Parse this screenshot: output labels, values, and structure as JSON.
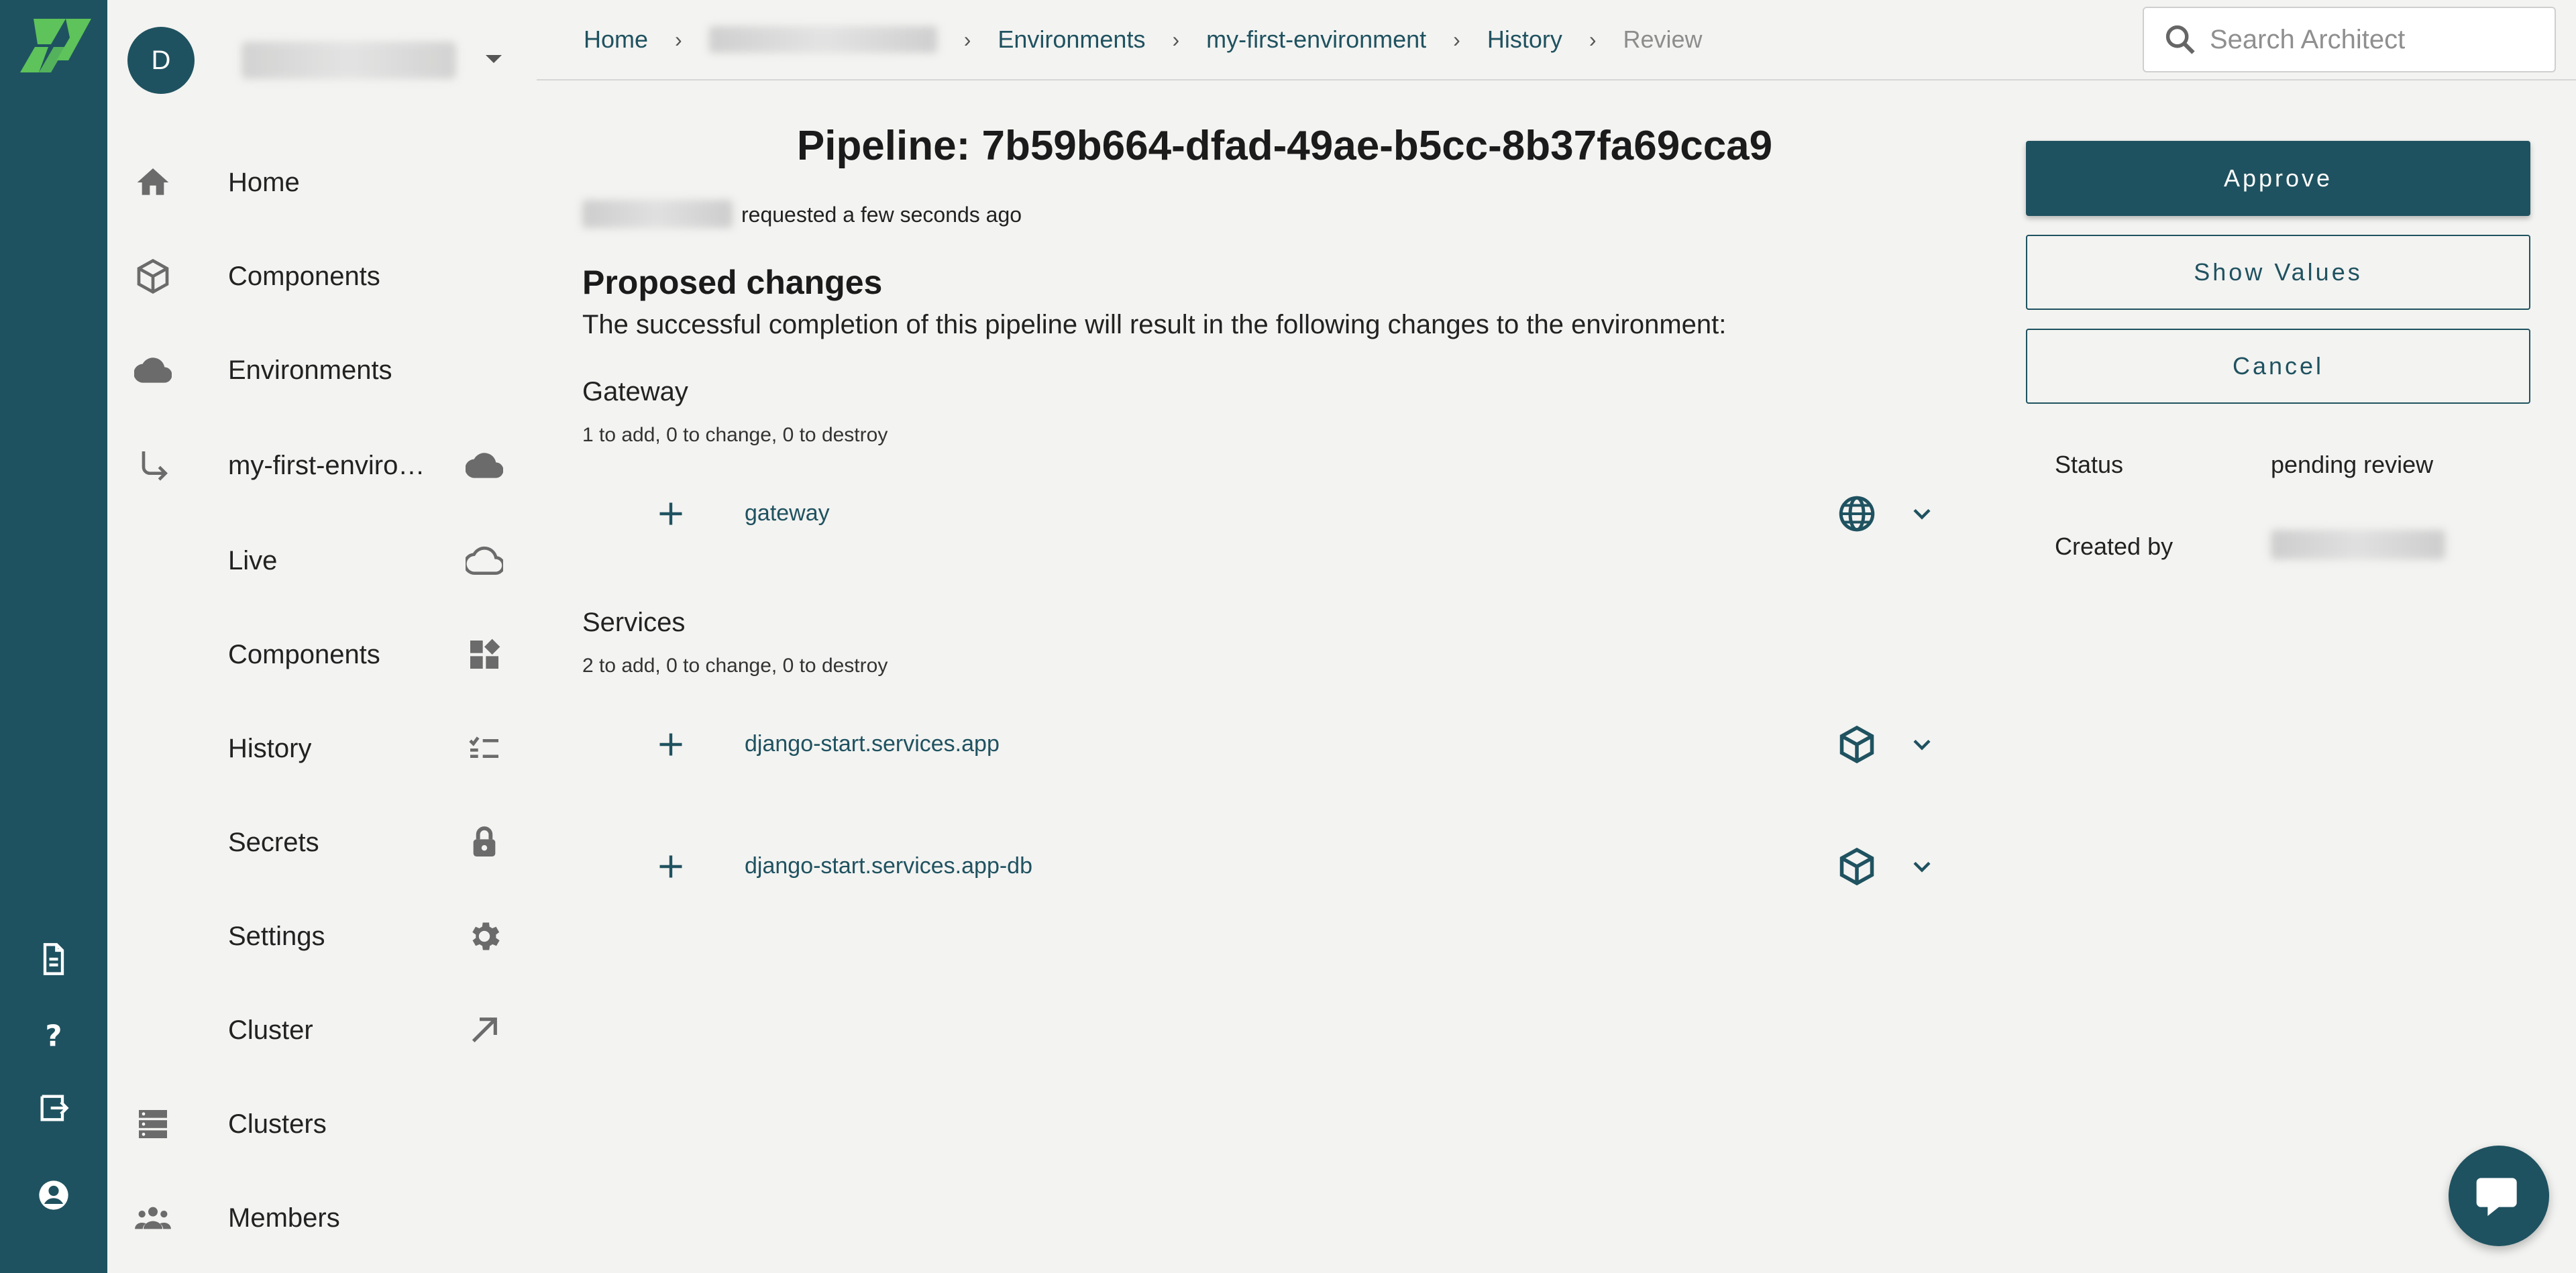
{
  "colors": {
    "brand": "#1f5260",
    "accent_green": "#5dc35a",
    "background": "#f3f3f1"
  },
  "account": {
    "avatar_initial": "D"
  },
  "sidebar": {
    "items": [
      {
        "label": "Home",
        "icon": "home-icon"
      },
      {
        "label": "Components",
        "icon": "cube-icon"
      },
      {
        "label": "Environments",
        "icon": "cloud-icon"
      },
      {
        "label": "my-first-environment",
        "icon": "subdirectory-arrow-icon",
        "right_icon": "cloud-icon"
      },
      {
        "label": "Live",
        "right_icon": "cloud-outline-icon"
      },
      {
        "label": "Components",
        "right_icon": "widgets-icon"
      },
      {
        "label": "History",
        "right_icon": "checklist-icon"
      },
      {
        "label": "Secrets",
        "right_icon": "lock-icon"
      },
      {
        "label": "Settings",
        "right_icon": "gear-icon"
      },
      {
        "label": "Cluster",
        "right_icon": "arrow-up-right-icon"
      },
      {
        "label": "Clusters",
        "icon": "server-icon"
      },
      {
        "label": "Members",
        "icon": "people-icon"
      }
    ]
  },
  "rail": {
    "icons": [
      "document-icon",
      "help-icon",
      "exit-icon",
      "account-icon"
    ]
  },
  "breadcrumb": {
    "home": "Home",
    "environments": "Environments",
    "environment": "my-first-environment",
    "history": "History",
    "current": "Review"
  },
  "search": {
    "placeholder": "Search Architect"
  },
  "pipeline": {
    "title": "Pipeline: 7b59b664-dfad-49ae-b5cc-8b37fa69cca9",
    "requested_text": "requested a few seconds ago"
  },
  "changes": {
    "heading": "Proposed changes",
    "description": "The successful completion of this pipeline will result in the following changes to the environment:",
    "groups": [
      {
        "title": "Gateway",
        "summary": "1 to add, 0 to change, 0 to destroy",
        "items": [
          {
            "name": "gateway",
            "icon": "globe-icon"
          }
        ]
      },
      {
        "title": "Services",
        "summary": "2 to add, 0 to change, 0 to destroy",
        "items": [
          {
            "name": "django-start.services.app",
            "icon": "cube-icon"
          },
          {
            "name": "django-start.services.app-db",
            "icon": "cube-icon"
          }
        ]
      }
    ]
  },
  "actions": {
    "approve": "Approve",
    "show_values": "Show Values",
    "cancel": "Cancel"
  },
  "details": {
    "status_label": "Status",
    "status_value": "pending review",
    "created_by_label": "Created by"
  }
}
